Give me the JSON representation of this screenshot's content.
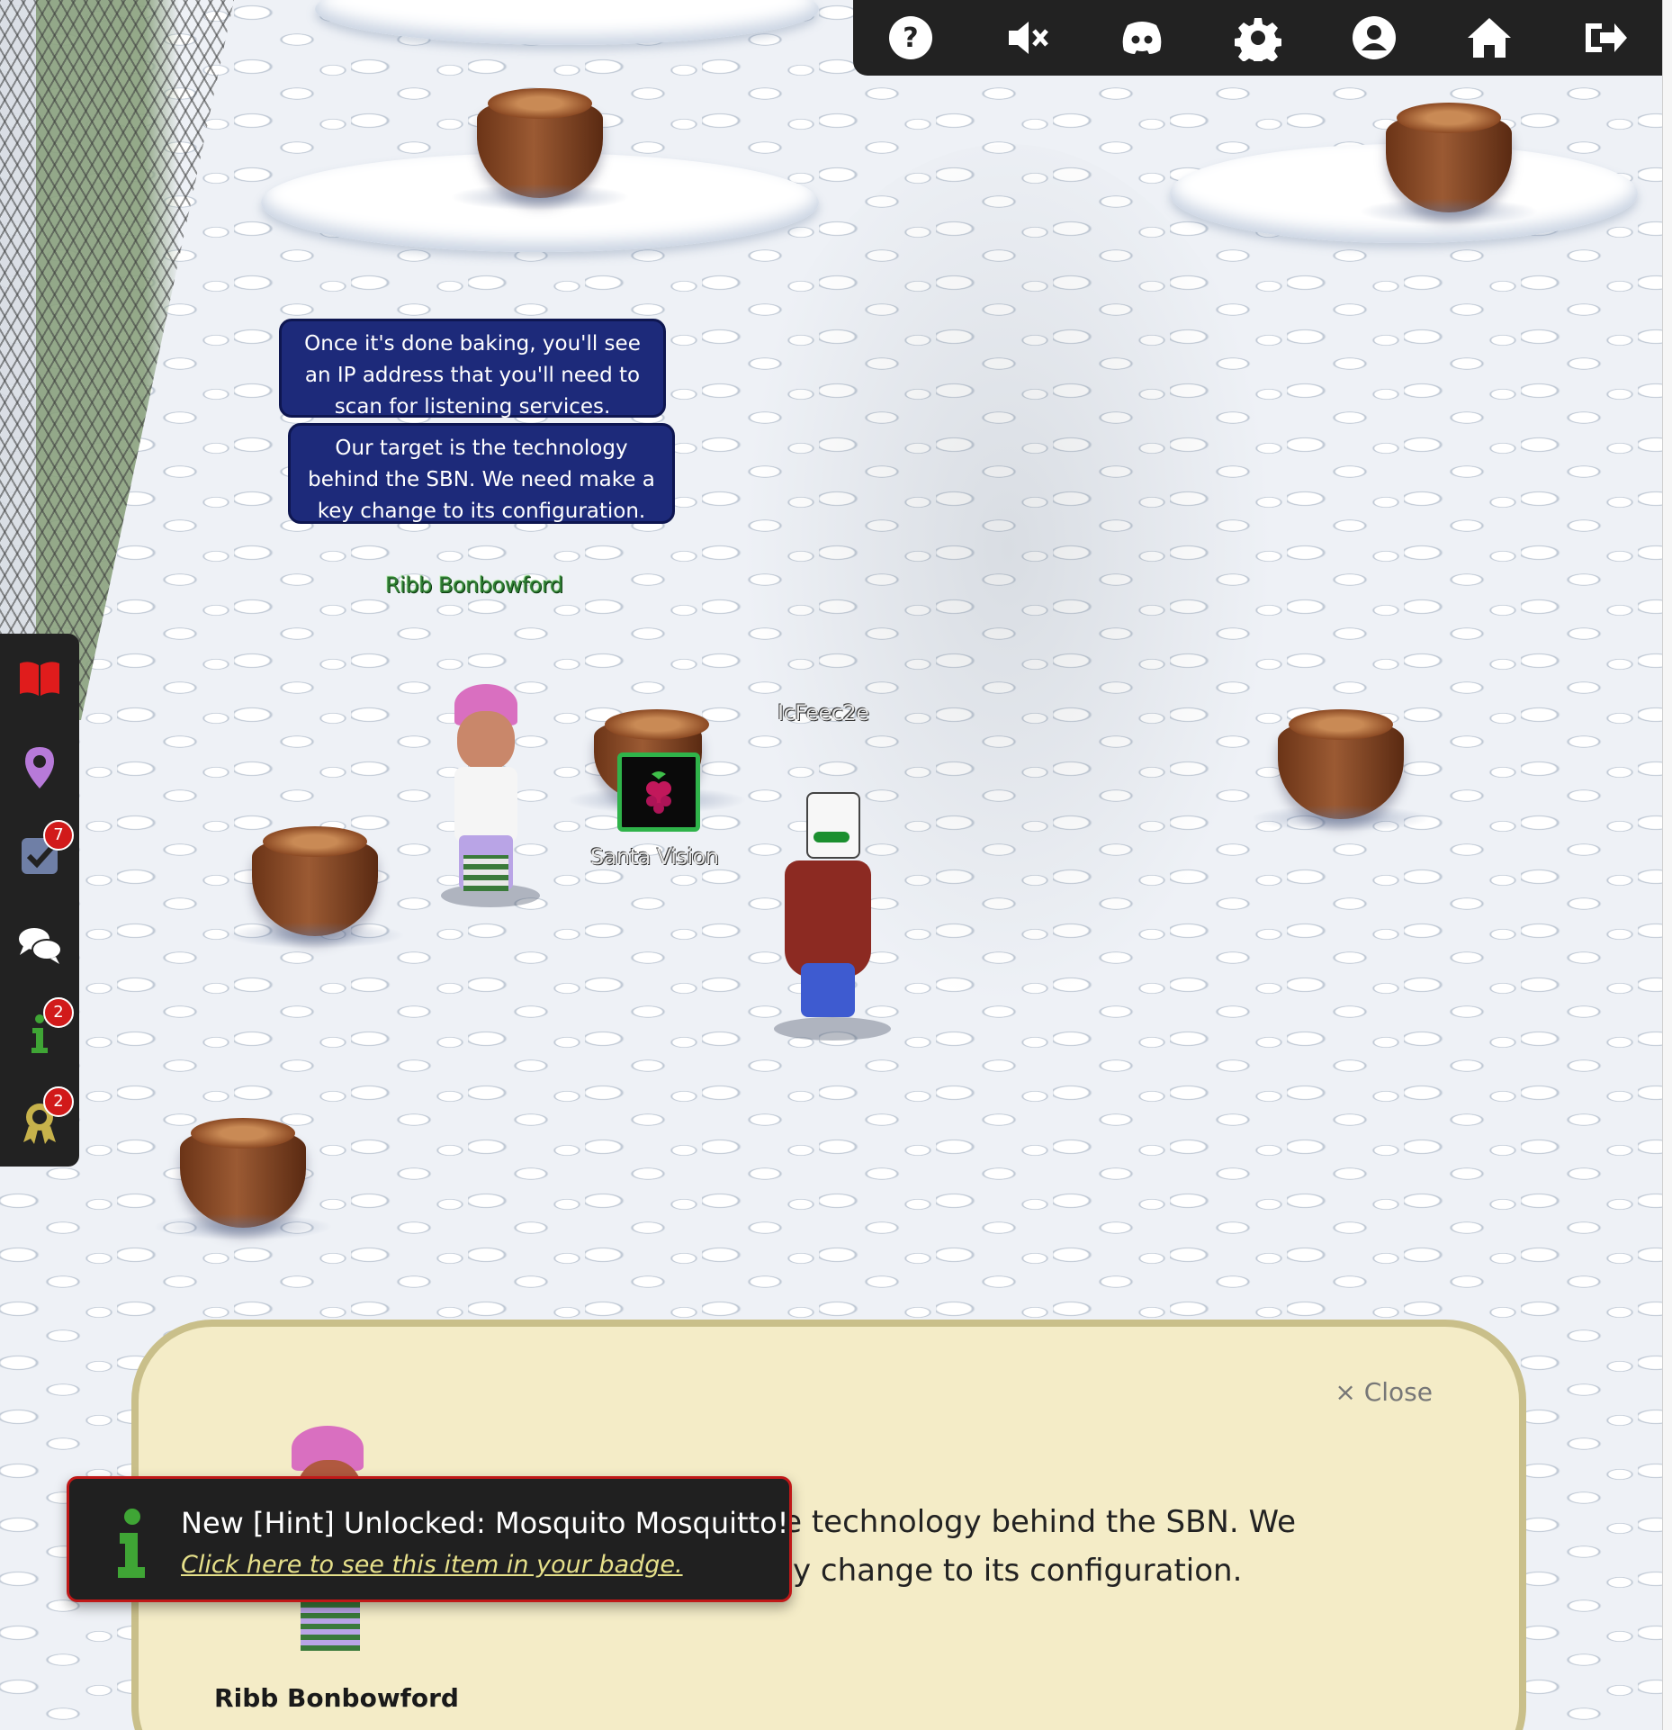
{
  "toolbar": {
    "icons": [
      "help-icon",
      "mute-icon",
      "discord-icon",
      "gear-icon",
      "user-icon",
      "home-icon",
      "logout-icon"
    ]
  },
  "sidebar": {
    "items": [
      {
        "icon": "book-icon",
        "badge": ""
      },
      {
        "icon": "map-pin-icon",
        "badge": ""
      },
      {
        "icon": "checklist-icon",
        "badge": "7"
      },
      {
        "icon": "chat-icon",
        "badge": ""
      },
      {
        "icon": "info-icon",
        "badge": "2"
      },
      {
        "icon": "achievement-icon",
        "badge": "2"
      }
    ]
  },
  "bubbles": [
    "Once it's done baking, you'll see an IP address that you'll need to scan for listening services.",
    "Our target is the technology behind the SBN. We need make a key change to its configuration."
  ],
  "names": {
    "npc": "Ribb Bonbowford",
    "terminal": "Santa Vision",
    "player": "IcFeec2e"
  },
  "dialog": {
    "close_label": "× Close",
    "text": "Our target is the technology behind the SBN. We need make a key change to its configuration.",
    "speaker": "Ribb Bonbowford"
  },
  "toast": {
    "title": "New [Hint] Unlocked: Mosquito Mosquitto!",
    "link": "Click here to see this item in your badge."
  },
  "colors": {
    "bubble_bg": "#1d2a7a",
    "toolbar_bg": "#222222",
    "badge_red": "#d11a1a",
    "dialog_bg": "#f4ecc7",
    "toast_border": "#c01818",
    "hint_green": "#3fa535"
  }
}
